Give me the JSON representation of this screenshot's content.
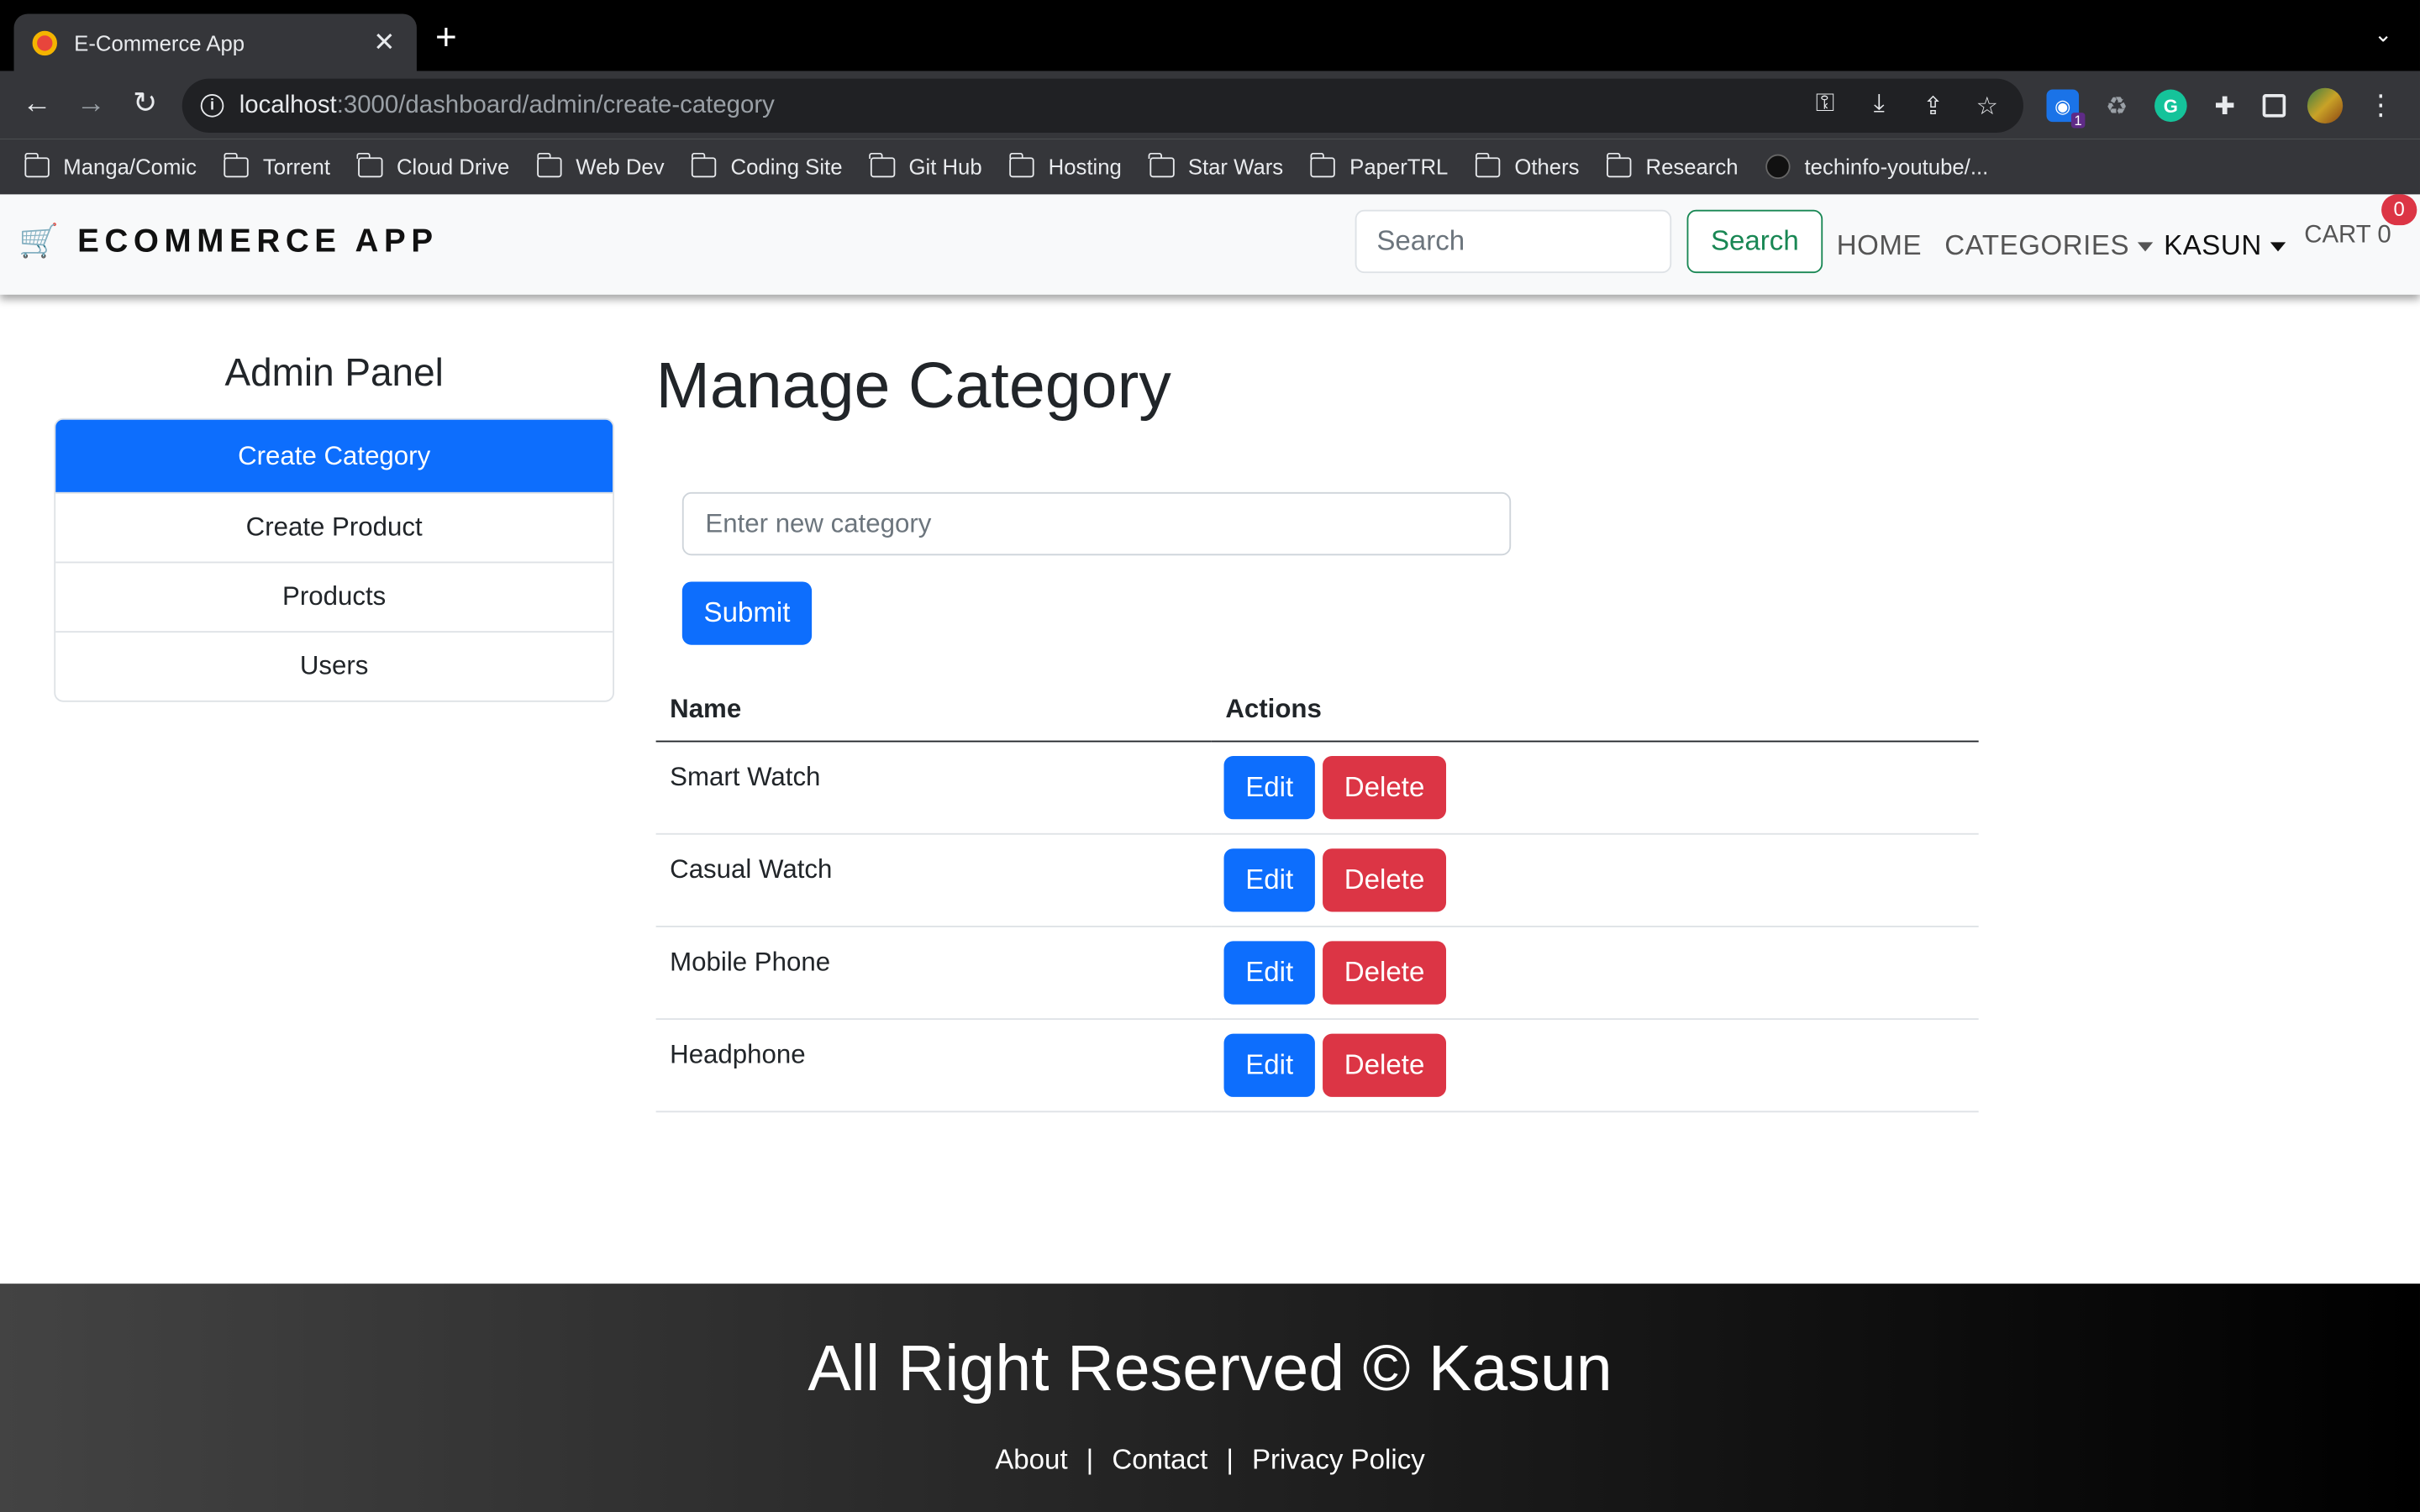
{
  "browser": {
    "tab_title": "E-Commerce App",
    "tab_close": "✕",
    "new_tab": "+",
    "url_host": "localhost",
    "url_rest": ":3000/dashboard/admin/create-category",
    "extension_badge": "1",
    "bookmarks": [
      "Manga/Comic",
      "Torrent",
      "Cloud Drive",
      "Web Dev",
      "Coding Site",
      "Git Hub",
      "Hosting",
      "Star Wars",
      "PaperTRL",
      "Others",
      "Research"
    ],
    "bookmark_link": "techinfo-youtube/..."
  },
  "navbar": {
    "brand_icon": "🛒",
    "brand": "ECOMMERCE APP",
    "search_placeholder": "Search",
    "search_button": "Search",
    "home": "HOME",
    "categories": "CATEGORIES",
    "user": "KASUN",
    "cart": "CART 0",
    "cart_badge": "0"
  },
  "sidebar": {
    "title": "Admin Panel",
    "items": [
      {
        "label": "Create Category",
        "active": true
      },
      {
        "label": "Create Product",
        "active": false
      },
      {
        "label": "Products",
        "active": false
      },
      {
        "label": "Users",
        "active": false
      }
    ]
  },
  "main": {
    "title": "Manage Category",
    "input_placeholder": "Enter new category",
    "submit_label": "Submit",
    "table": {
      "headers": [
        "Name",
        "Actions"
      ],
      "rows": [
        {
          "name": "Smart Watch"
        },
        {
          "name": "Casual Watch"
        },
        {
          "name": "Mobile Phone"
        },
        {
          "name": "Headphone"
        }
      ],
      "edit_label": "Edit",
      "delete_label": "Delete"
    }
  },
  "footer": {
    "text": "All Right Reserved © Kasun",
    "links": [
      "About",
      "Contact",
      "Privacy Policy"
    ],
    "separator": "|"
  },
  "colors": {
    "primary": "#0d6efd",
    "danger": "#dc3545",
    "success": "#198754"
  }
}
